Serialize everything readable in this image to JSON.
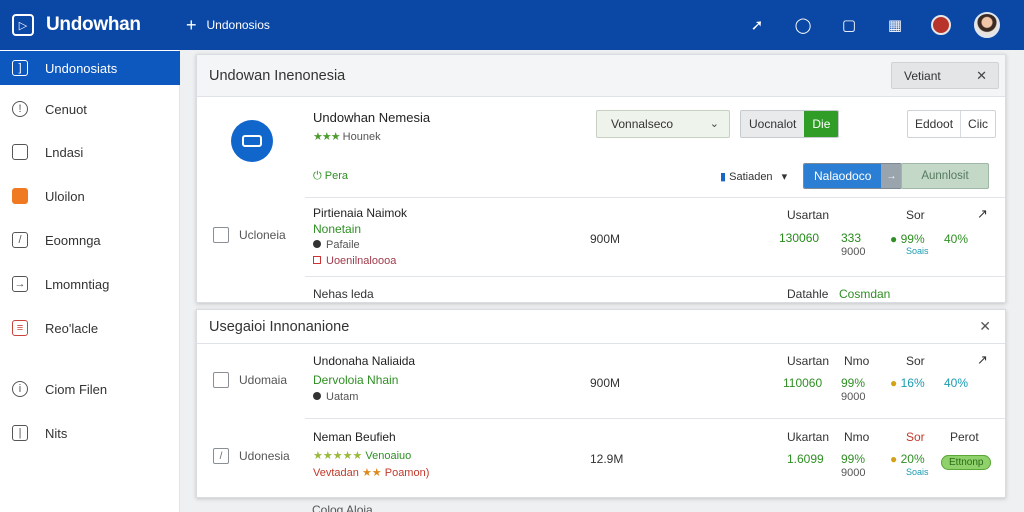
{
  "app": {
    "name": "Undowhan",
    "new_label": "Undonosios"
  },
  "sidebar": {
    "items": [
      {
        "label": "Undonosiats"
      },
      {
        "label": "Cenuot"
      },
      {
        "label": "Lndasi"
      },
      {
        "label": "Uloilon"
      },
      {
        "label": "Eoomnga"
      },
      {
        "label": "Lmomntiag"
      },
      {
        "label": "Reo'lacle"
      },
      {
        "label": "Ciom Filen"
      },
      {
        "label": "Nits"
      }
    ]
  },
  "panel1": {
    "title": "Undowan Inenonesia",
    "variant_label": "Vetiant",
    "company": {
      "name": "Undowhan Nemesia",
      "rating_text": "Hounek",
      "stars": "★★★"
    },
    "status_label": "Pera",
    "select_value": "Vonnalseco",
    "split_btn": {
      "a": "Uocnalot",
      "b": "Die"
    },
    "pair_btn": {
      "a": "Eddoot",
      "b": "Ciic"
    },
    "sort_label": "Satiaden",
    "primary_btn": "Nalaodoco",
    "secondary_btn": "Aunnlosit",
    "row": {
      "checkbox_label": "Ucloneia",
      "title": "Pirtienaia Naimok",
      "subtitle": "Nonetain",
      "line3": "Pafaile",
      "line4": "Uoenilnaloooa",
      "amount": "900M",
      "col_head": "Usartan",
      "col_val": "130060",
      "v1": "333",
      "v2": "9000",
      "col_head2": "Sor",
      "pct1": "99%",
      "pct1_sub": "Soais",
      "pct2": "40%"
    },
    "footer": {
      "left": "Nehas leda",
      "mid": "Datahle",
      "right": "Cosmdan"
    }
  },
  "panel2": {
    "title": "Usegaioi Innonanione",
    "rows": [
      {
        "checkbox_label": "Udomaia",
        "title": "Undonaha Naliaida",
        "subtitle": "Dervoloia Nhain",
        "line3": "Uatam",
        "amount": "900M",
        "col_head": "Usartan",
        "col_head_b": "Nmo",
        "col_head2": "Sor",
        "col_val": "110060",
        "v1": "99%",
        "v2": "9000",
        "pct1": "16%",
        "pct2": "40%"
      },
      {
        "checkbox_label": "Udonesia",
        "title": "Neman Beufieh",
        "subtitle": "Venoaiuo",
        "stars": "★★★★★",
        "line3": "Vevtadan",
        "line3_stars": "★★",
        "line3_tail": "Poamon)",
        "amount": "12.9M",
        "col_head": "Ukartan",
        "col_head_b": "Nmo",
        "col_head2": "Sor",
        "col_head3": "Perot",
        "col_val": "1.6099",
        "v1": "99%",
        "v2": "9000",
        "pct1": "20%",
        "pct1_sub": "Soais",
        "pill": "Ettnonp"
      }
    ],
    "footer": "Colog Aloia"
  },
  "colors": {
    "topbar": "#0b48a6",
    "sidebar_active": "#0d58bf",
    "accent_green": "#2f9d26",
    "accent_blue": "#2a7fd4"
  }
}
